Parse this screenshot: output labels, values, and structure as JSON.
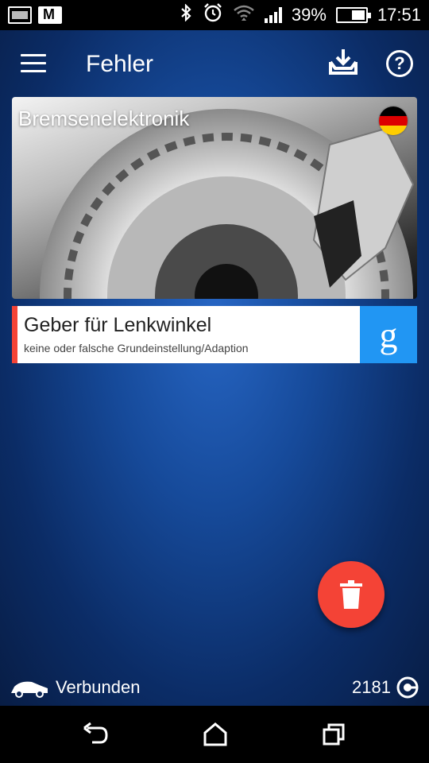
{
  "status_bar": {
    "battery": "39%",
    "time": "17:51",
    "icons": [
      "image-notification-icon",
      "gmail-icon",
      "bluetooth-icon",
      "alarm-icon",
      "wifi-icon",
      "signal-icon",
      "battery-icon"
    ]
  },
  "header": {
    "title": "Fehler",
    "icons": [
      "menu-icon",
      "download-inbox-icon",
      "help-icon"
    ]
  },
  "card": {
    "title": "Bremsenelektronik",
    "image": "brake-disc-photo",
    "flag": "germany-flag"
  },
  "errors": [
    {
      "title": "Geber für Lenkwinkel",
      "description": "keine oder falsche Grundeinstellung/Adaption",
      "action_icon": "google-search-icon"
    }
  ],
  "fab": {
    "icon": "trash-icon"
  },
  "footer": {
    "connection_status": "Verbunden",
    "count": "2181"
  },
  "colors": {
    "accent_red": "#f44336",
    "google_blue": "#2196f3",
    "background_blue": "#1a56b0"
  }
}
